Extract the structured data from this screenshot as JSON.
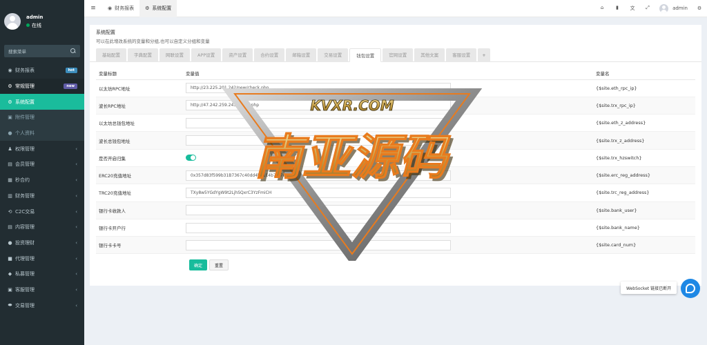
{
  "user": {
    "name": "admin",
    "status": "在线"
  },
  "sidebar": {
    "search_placeholder": "搜索菜单",
    "items": [
      {
        "label": "财务报表",
        "icon": "dashboard-icon",
        "glyph": "◉",
        "badge": "hot",
        "state": "normal"
      },
      {
        "label": "常规管理",
        "icon": "cogs-icon",
        "glyph": "⚙",
        "badge": "new",
        "state": "open"
      },
      {
        "label": "系统配置",
        "icon": "gear-icon",
        "glyph": "⚙",
        "state": "active"
      },
      {
        "label": "附件管理",
        "icon": "file-image-icon",
        "glyph": "▣",
        "state": "sub"
      },
      {
        "label": "个人资料",
        "icon": "user-icon",
        "glyph": "●",
        "state": "sub"
      },
      {
        "label": "权限管理",
        "icon": "group-icon",
        "glyph": "♟",
        "chevron": "‹",
        "state": "normal"
      },
      {
        "label": "会员管理",
        "icon": "users-icon",
        "glyph": "▤",
        "chevron": "‹",
        "state": "normal"
      },
      {
        "label": "秒合约",
        "icon": "calendar-icon",
        "glyph": "▦",
        "chevron": "‹",
        "state": "normal"
      },
      {
        "label": "财务管理",
        "icon": "money-icon",
        "glyph": "▥",
        "chevron": "‹",
        "state": "normal"
      },
      {
        "label": "C2C交易",
        "icon": "exchange-icon",
        "glyph": "⟲",
        "chevron": "‹",
        "state": "normal"
      },
      {
        "label": "内容管理",
        "icon": "content-icon",
        "glyph": "▤",
        "chevron": "‹",
        "state": "normal"
      },
      {
        "label": "投资理财",
        "icon": "invest-icon",
        "glyph": "●",
        "chevron": "‹",
        "state": "normal"
      },
      {
        "label": "代理管理",
        "icon": "agent-icon",
        "glyph": "■",
        "chevron": "‹",
        "state": "normal"
      },
      {
        "label": "私募管理",
        "icon": "diamond-icon",
        "glyph": "◆",
        "chevron": "‹",
        "state": "normal"
      },
      {
        "label": "客服管理",
        "icon": "service-icon",
        "glyph": "▣",
        "chevron": "‹",
        "state": "normal"
      },
      {
        "label": "交易管理",
        "icon": "trade-icon",
        "glyph": "⬬",
        "chevron": "‹",
        "state": "normal"
      }
    ]
  },
  "topbar": {
    "tabs": [
      {
        "label": "财务报表",
        "icon": "dashboard-icon",
        "glyph": "◉",
        "active": false
      },
      {
        "label": "系统配置",
        "icon": "gear-icon",
        "glyph": "⚙",
        "active": true
      }
    ],
    "right_icons": [
      {
        "icon": "home-icon",
        "glyph": "⌂"
      },
      {
        "icon": "trash-icon",
        "glyph": "▮"
      },
      {
        "icon": "language-icon",
        "glyph": "文"
      },
      {
        "icon": "fullscreen-icon",
        "glyph": "⤢"
      }
    ],
    "username": "admin",
    "settings_icon": "⚙"
  },
  "panel": {
    "title": "系统配置",
    "description": "可以在此增改系统的变量和分组,也可以自定义分组和变量"
  },
  "tabs": [
    {
      "label": "基础配置",
      "active": false
    },
    {
      "label": "字典配置",
      "active": false
    },
    {
      "label": "网联设置",
      "active": false
    },
    {
      "label": "APP设置",
      "active": false
    },
    {
      "label": "资产设置",
      "active": false
    },
    {
      "label": "合约设置",
      "active": false
    },
    {
      "label": "邮箱设置",
      "active": false
    },
    {
      "label": "交易设置",
      "active": false
    },
    {
      "label": "钱包设置",
      "active": true
    },
    {
      "label": "官网设置",
      "active": false
    },
    {
      "label": "其他文案",
      "active": false
    },
    {
      "label": "客服设置",
      "active": false
    }
  ],
  "add_tab_label": "+",
  "table": {
    "headers": {
      "title": "变量标题",
      "value": "变量值",
      "name": "变量名"
    },
    "rows": [
      {
        "title": "以太坊RPC地址",
        "value": "http://23.225.201.242/new/check.php",
        "name": "{$site.eth_rpc_ip}",
        "type": "text"
      },
      {
        "title": "波长RPC地址",
        "value": "http://47.242.259.243/check.php",
        "name": "{$site.trx_rpc_ip}",
        "type": "text"
      },
      {
        "title": "以太坊总钱包地址",
        "value": "",
        "name": "{$site.eth_z_address}",
        "type": "text"
      },
      {
        "title": "波长总钱包地址",
        "value": "",
        "name": "{$site.trx_z_address}",
        "type": "text"
      },
      {
        "title": "是否开启归集",
        "value": "",
        "name": "{$site.trx_hzswitch}",
        "type": "toggle"
      },
      {
        "title": "ERC20充值地址",
        "value": "0x357d83f599b31B7367c40dd4b21E4b78f7e9d53e",
        "name": "{$site.erc_reg_address}",
        "type": "text"
      },
      {
        "title": "TRC20充值地址",
        "value": "TXy8w5YGdYgW9t2LjhSQxrC3YzFmiCH",
        "name": "{$site.trc_reg_address}",
        "type": "text"
      },
      {
        "title": "银行卡收款人",
        "value": "",
        "name": "{$site.bank_user}",
        "type": "text"
      },
      {
        "title": "银行卡开户行",
        "value": "",
        "name": "{$site.bank_name}",
        "type": "text"
      },
      {
        "title": "银行卡卡号",
        "value": "",
        "name": "{$site.card_num}",
        "type": "text"
      }
    ]
  },
  "buttons": {
    "submit": "确定",
    "reset": "重置"
  },
  "watermark": {
    "top": "KVXR.COM",
    "main": "南亚源码"
  },
  "notice": {
    "websocket": "WebSocket 链接已断开"
  },
  "colors": {
    "accent": "#18bc9c",
    "sidebar_bg": "#222d32",
    "chat_blue": "#1e88e5"
  }
}
